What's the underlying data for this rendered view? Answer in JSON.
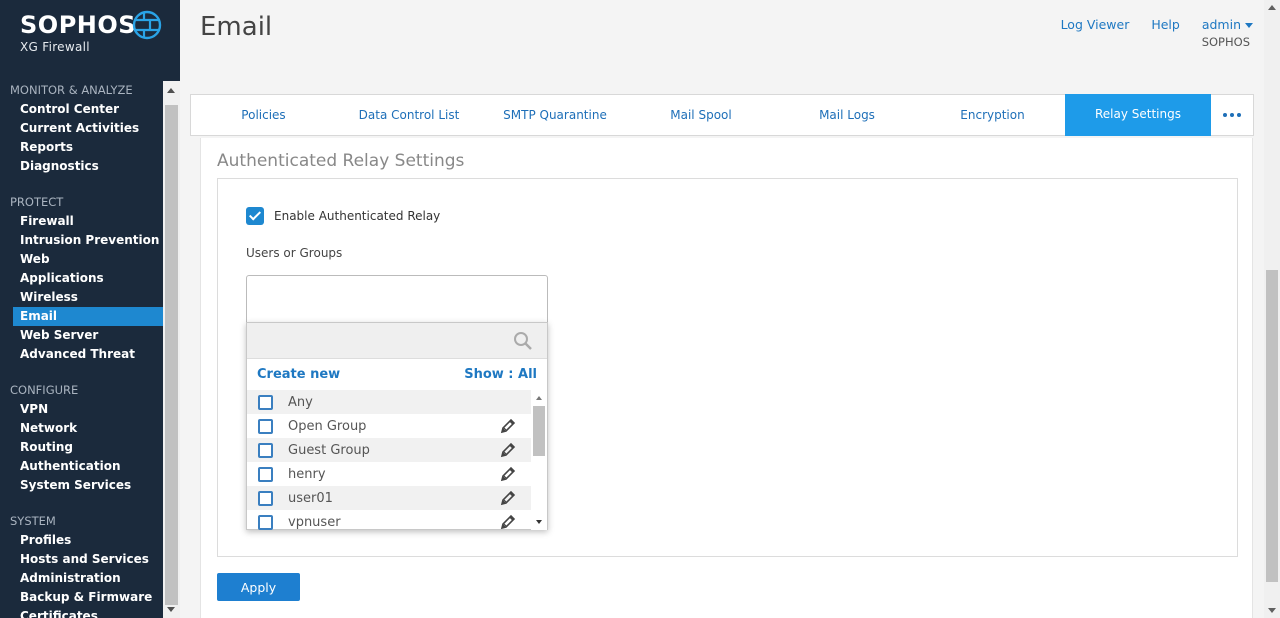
{
  "brand": {
    "name": "SOPHOS",
    "product": "XG Firewall",
    "logo_icon": "sophos-globe-icon"
  },
  "sidebar": {
    "sections": [
      {
        "title": "MONITOR & ANALYZE",
        "items": [
          "Control Center",
          "Current Activities",
          "Reports",
          "Diagnostics"
        ]
      },
      {
        "title": "PROTECT",
        "items": [
          "Firewall",
          "Intrusion Prevention",
          "Web",
          "Applications",
          "Wireless",
          "Email",
          "Web Server",
          "Advanced Threat"
        ]
      },
      {
        "title": "CONFIGURE",
        "items": [
          "VPN",
          "Network",
          "Routing",
          "Authentication",
          "System Services"
        ]
      },
      {
        "title": "SYSTEM",
        "items": [
          "Profiles",
          "Hosts and Services",
          "Administration",
          "Backup & Firmware",
          "Certificates"
        ]
      }
    ],
    "active_item": "Email"
  },
  "header": {
    "title": "Email",
    "links": {
      "log_viewer": "Log Viewer",
      "help": "Help",
      "admin": "admin"
    },
    "org": "SOPHOS"
  },
  "tabs": {
    "items": [
      "Policies",
      "Data Control List",
      "SMTP Quarantine",
      "Mail Spool",
      "Mail Logs",
      "Encryption",
      "Relay Settings"
    ],
    "active": "Relay Settings",
    "more_icon": "more-dots-icon"
  },
  "relay": {
    "section_title": "Authenticated Relay Settings",
    "enable_label": "Enable Authenticated Relay",
    "enable_checked": true,
    "users_label": "Users or Groups",
    "dropdown": {
      "create_new": "Create new",
      "show": "Show : All",
      "items": [
        {
          "label": "Any",
          "editable": false
        },
        {
          "label": "Open Group",
          "editable": true
        },
        {
          "label": "Guest Group",
          "editable": true
        },
        {
          "label": "henry",
          "editable": true
        },
        {
          "label": "user01",
          "editable": true
        },
        {
          "label": "vpnuser",
          "editable": true
        }
      ]
    },
    "apply_label": "Apply"
  },
  "colors": {
    "sidebar_bg": "#1b2a3c",
    "accent": "#1e88d0",
    "tab_active": "#1e9be9",
    "link": "#1e78c2"
  }
}
